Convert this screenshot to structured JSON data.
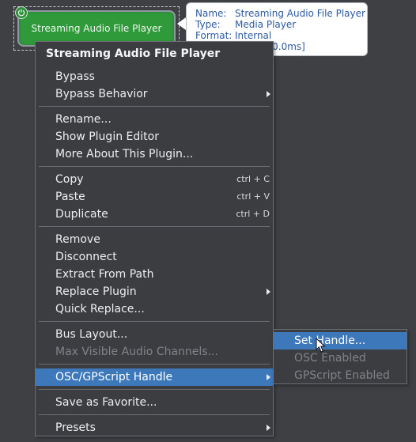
{
  "node": {
    "label": "Streaming Audio File Player",
    "power_icon": "power-icon",
    "fill_color": "#2f9a39"
  },
  "tooltip": {
    "name_key": "Name:",
    "name_val": "Streaming Audio File Player",
    "type_key": "Type:",
    "type_val": "Media Player",
    "format_key": "Format:",
    "format_val": "Internal",
    "latency_partial": "es [0.0ms]"
  },
  "menu": {
    "title": "Streaming Audio File Player",
    "items": [
      {
        "label": "Bypass"
      },
      {
        "label": "Bypass Behavior",
        "submenu": true
      },
      {
        "label": "Rename..."
      },
      {
        "label": "Show Plugin Editor"
      },
      {
        "label": "More About This Plugin..."
      },
      {
        "label": "Copy",
        "shortcut": "ctrl + C"
      },
      {
        "label": "Paste",
        "shortcut": "ctrl + V"
      },
      {
        "label": "Duplicate",
        "shortcut": "ctrl + D"
      },
      {
        "label": "Remove"
      },
      {
        "label": "Disconnect"
      },
      {
        "label": "Extract From Path"
      },
      {
        "label": "Replace Plugin",
        "submenu": true
      },
      {
        "label": "Quick Replace..."
      },
      {
        "label": "Bus Layout..."
      },
      {
        "label": "Max Visible Audio Channels...",
        "disabled": true
      },
      {
        "label": "OSC/GPScript Handle",
        "submenu": true,
        "highlighted": true
      },
      {
        "label": "Save as Favorite..."
      },
      {
        "label": "Presets",
        "submenu": true
      }
    ]
  },
  "submenu": {
    "items": [
      {
        "label": "Set Handle...",
        "highlighted": true
      },
      {
        "label": "OSC Enabled",
        "disabled": true
      },
      {
        "label": "GPScript Enabled",
        "disabled": true
      }
    ]
  },
  "colors": {
    "background": "#3f4044",
    "menu_bg": "#3c3d41",
    "highlight": "#3d78ba",
    "disabled_text": "#7f8388",
    "tooltip_text": "#2c5aa0"
  }
}
